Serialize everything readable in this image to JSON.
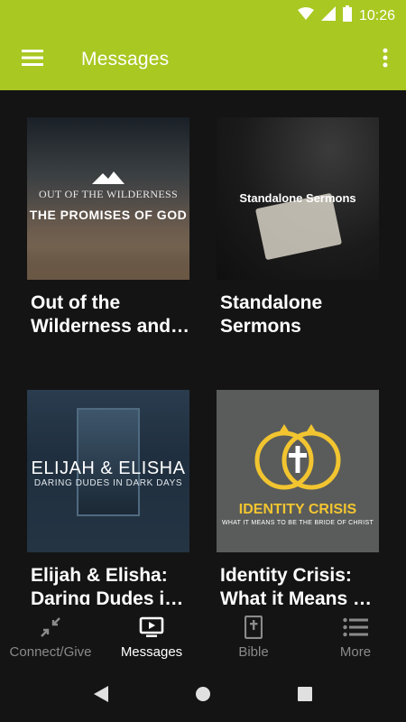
{
  "status_bar": {
    "time": "10:26"
  },
  "app_bar": {
    "title": "Messages"
  },
  "cards": [
    {
      "title": "Out of the Wilderness and…",
      "art_line1": "OUT OF THE WILDERNESS",
      "art_line2": "THE PROMISES OF GOD"
    },
    {
      "title": "Standalone Sermons",
      "art_line1": "Standalone Sermons"
    },
    {
      "title": "Elijah & Elisha: Daring Dudes i…",
      "art_line1": "ELIJAH & ELISHA",
      "art_line2": "DARING DUDES IN DARK DAYS"
    },
    {
      "title": "Identity Crisis: What it Means …",
      "art_line1": "IDENTITY CRISIS",
      "art_line2": "WHAT IT MEANS TO BE THE BRIDE OF CHRIST"
    }
  ],
  "bottom_nav": {
    "items": [
      {
        "label": "Connect/Give",
        "icon": "arrows-compress-icon"
      },
      {
        "label": "Messages",
        "icon": "tv-play-icon",
        "active": true
      },
      {
        "label": "Bible",
        "icon": "bible-icon"
      },
      {
        "label": "More",
        "icon": "list-icon"
      }
    ]
  },
  "colors": {
    "accent": "#a9c822",
    "background": "#141414",
    "inactive": "#8a8a8a"
  }
}
